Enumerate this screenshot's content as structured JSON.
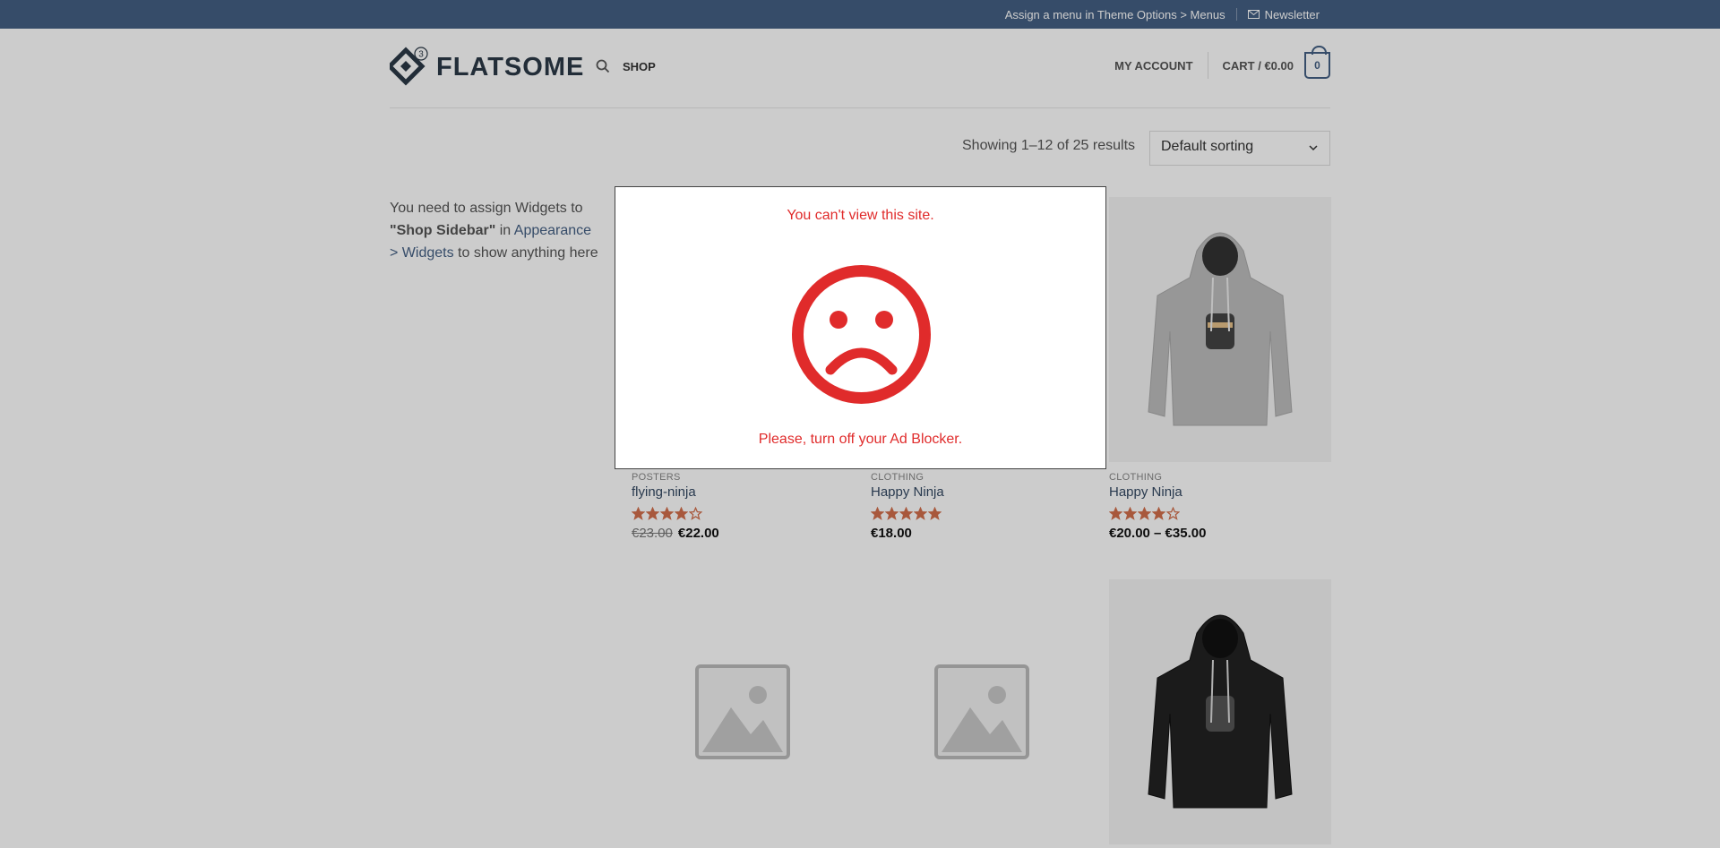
{
  "topbar": {
    "menu_notice": "Assign a menu in Theme Options > Menus",
    "newsletter": "Newsletter"
  },
  "header": {
    "logo_text": "FLATSOME",
    "logo_badge": "3",
    "shop": "SHOP",
    "my_account": "MY ACCOUNT",
    "cart": "CART / €0.00",
    "cart_count": "0"
  },
  "shop": {
    "results": "Showing 1–12 of 25 results",
    "sorting": "Default sorting"
  },
  "sidebar": {
    "text_1": "You need to assign Widgets to",
    "bold": "\"Shop Sidebar\"",
    "text_2": "in",
    "link_1": "Appearance >",
    "link_2": "Widgets",
    "text_3": "to show anything here"
  },
  "products": [
    {
      "category": "POSTERS",
      "name": "flying-ninja",
      "rating": 4,
      "old_price": "€23.00",
      "price": "€22.00"
    },
    {
      "category": "CLOTHING",
      "name": "Happy Ninja",
      "rating": 5,
      "price": "€18.00"
    },
    {
      "category": "CLOTHING",
      "name": "Happy Ninja",
      "rating": 4,
      "price": "€20.00 – €35.00",
      "image": "grey-hoodie"
    }
  ],
  "second_row_images": [
    "placeholder-image",
    "placeholder-image",
    "black-hoodie"
  ],
  "modal": {
    "title": "You can't view this site.",
    "message": "Please, turn off your Ad Blocker.",
    "icon": "sad-face-icon"
  },
  "colors": {
    "primary": "#446084",
    "alert": "#e02b2b",
    "star": "#d26e4b"
  }
}
